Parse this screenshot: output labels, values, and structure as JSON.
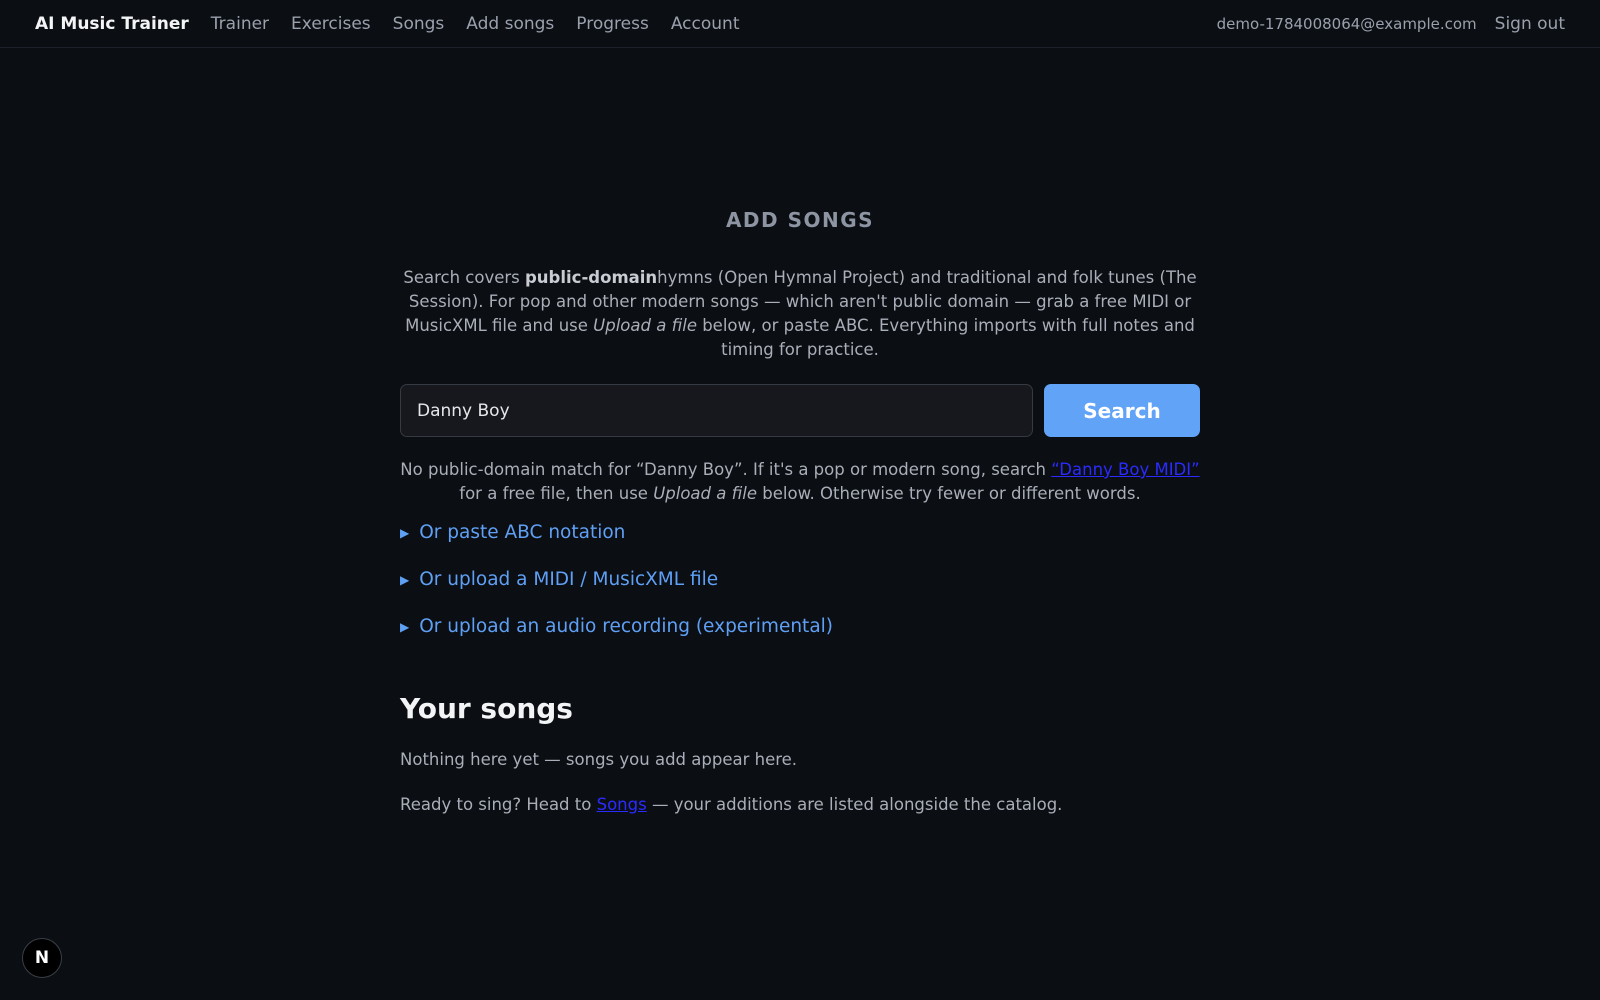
{
  "nav": {
    "brand": "AI Music Trainer",
    "links": [
      "Trainer",
      "Exercises",
      "Songs",
      "Add songs",
      "Progress",
      "Account"
    ],
    "email": "demo-1784008064@example.com",
    "signout": "Sign out"
  },
  "page": {
    "title": "ADD SONGS",
    "intro": {
      "p1": "Search covers ",
      "bold": "public-domain",
      "p2": "hymns (Open Hymnal Project) and traditional and folk tunes (The Session). For pop and other modern songs — which aren't public domain — grab a free MIDI or MusicXML file and use ",
      "italic": "Upload a file",
      "p3": " below, or paste ABC. Everything imports with full notes and timing for practice."
    },
    "search": {
      "value": "Danny Boy",
      "button": "Search"
    },
    "nomatch": {
      "p1": "No public-domain match for “Danny Boy”. If it's a pop or modern song, search ",
      "link": "“Danny Boy MIDI”",
      "p2": " for a free file, then use ",
      "italic": "Upload a file",
      "p3": " below. Otherwise try fewer or different words."
    },
    "options": [
      "Or paste ABC notation",
      "Or upload a MIDI / MusicXML file",
      "Or upload an audio recording (experimental)"
    ],
    "your_songs": {
      "heading": "Your songs",
      "empty": "Nothing here yet — songs you add appear here.",
      "hint_p1": "Ready to sing? Head to ",
      "hint_link": "Songs",
      "hint_p2": " — your additions are listed alongside the catalog."
    }
  },
  "badge": "N",
  "icons": {
    "disclosure": "triangle-right-icon"
  },
  "colors": {
    "accent": "#60a3f7",
    "link": "#5fa0f5",
    "background": "#0b0e13"
  }
}
